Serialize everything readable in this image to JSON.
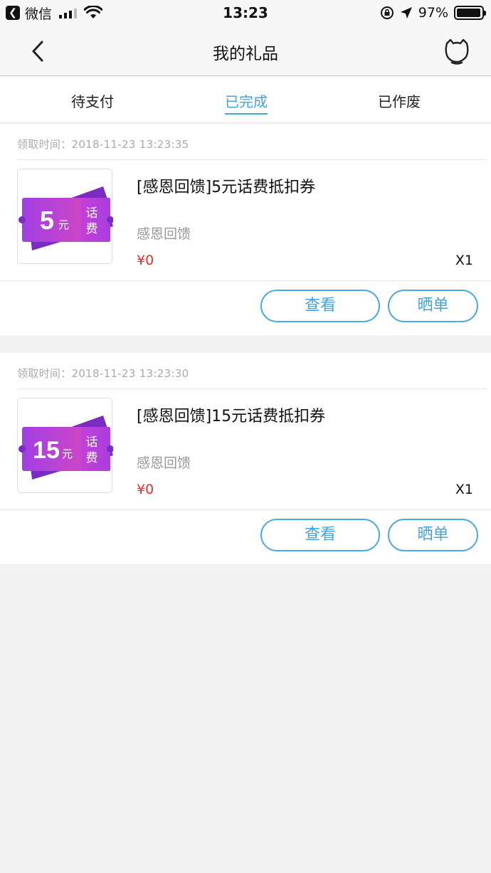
{
  "status_bar": {
    "app_name": "微信",
    "time": "13:23",
    "battery_percent": "97%",
    "battery_level": 0.97
  },
  "nav": {
    "title": "我的礼品"
  },
  "tabs": [
    {
      "label": "待支付",
      "active": false
    },
    {
      "label": "已完成",
      "active": true
    },
    {
      "label": "已作废",
      "active": false
    }
  ],
  "orders": [
    {
      "claim_time": "领取时间：2018-11-23 13:23:35",
      "title": "[感恩回馈]5元话费抵扣券",
      "brand": "感恩回馈",
      "price": "¥0",
      "quantity": "X1",
      "coupon": {
        "amount": "5",
        "unit": "元",
        "label_1": "话",
        "label_2": "费"
      },
      "view_label": "查看",
      "share_label": "晒单"
    },
    {
      "claim_time": "领取时间：2018-11-23 13:23:30",
      "title": "[感恩回馈]15元话费抵扣券",
      "brand": "感恩回馈",
      "price": "¥0",
      "quantity": "X1",
      "coupon": {
        "amount": "15",
        "unit": "元",
        "label_1": "话",
        "label_2": "费"
      },
      "view_label": "查看",
      "share_label": "晒单"
    }
  ],
  "colors": {
    "accent": "#3fa3e6",
    "price": "#f02b2b",
    "coupon_purple": "#9b2fd8",
    "background": "#f3f3f3"
  }
}
